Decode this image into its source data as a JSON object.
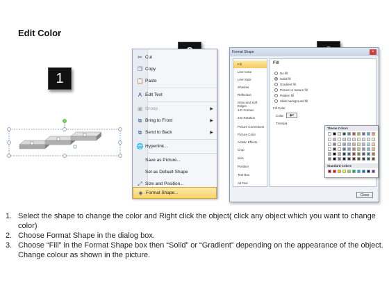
{
  "title": "Edit Color",
  "badges": [
    "1",
    "2",
    "3"
  ],
  "context_menu": {
    "items": [
      {
        "label": "Cut",
        "icon": "scissors-icon"
      },
      {
        "label": "Copy",
        "icon": "copy-icon"
      },
      {
        "label": "Paste",
        "icon": "paste-icon"
      },
      {
        "label": "Edit Text",
        "icon": "edit-text-icon"
      },
      {
        "label": "Group",
        "icon": "group-icon",
        "disabled": true,
        "submenu": true
      },
      {
        "label": "Bring to Front",
        "icon": "bring-front-icon",
        "submenu": true
      },
      {
        "label": "Send to Back",
        "icon": "send-back-icon",
        "submenu": true
      },
      {
        "label": "Hyperlink...",
        "icon": "hyperlink-icon"
      },
      {
        "label": "Save as Picture...",
        "icon": ""
      },
      {
        "label": "Set as Default Shape",
        "icon": ""
      },
      {
        "label": "Size and Position...",
        "icon": "size-icon"
      },
      {
        "label": "Format Shape...",
        "icon": "format-icon",
        "highlighted": true
      }
    ]
  },
  "dialog": {
    "title": "Format Shape",
    "close_glyph": "×",
    "categories": [
      "Fill",
      "Line Color",
      "Line Style",
      "Shadow",
      "Reflection",
      "Glow and Soft Edges",
      "3-D Format",
      "3-D Rotation",
      "Picture Corrections",
      "Picture Color",
      "Artistic Effects",
      "Crop",
      "Size",
      "Position",
      "Text Box",
      "Alt Text"
    ],
    "selected_category": "Fill",
    "fill_heading": "Fill",
    "options": [
      {
        "label": "No fill",
        "on": false
      },
      {
        "label": "Solid fill",
        "on": true
      },
      {
        "label": "Gradient fill",
        "on": false
      },
      {
        "label": "Picture or texture fill",
        "on": false
      },
      {
        "label": "Pattern fill",
        "on": false
      },
      {
        "label": "Slide background fill",
        "on": false
      }
    ],
    "fill_color_label": "Fill Color",
    "color_label": "Color:",
    "transparency_label": "Transpa",
    "theme_colors_label": "Theme Colors",
    "standard_colors_label": "Standard Colors",
    "close_label": "Close",
    "theme_top_row": [
      "#ffffff",
      "#000000",
      "#eeece1",
      "#1f497d",
      "#4f81bd",
      "#c0504d",
      "#9bbb59",
      "#8064a2",
      "#4bacc6",
      "#f79646"
    ],
    "standard_colors": [
      "#c00000",
      "#ff0000",
      "#ffc000",
      "#ffff00",
      "#92d050",
      "#00b050",
      "#00b0f0",
      "#0070c0",
      "#002060",
      "#7030a0"
    ]
  },
  "instructions": [
    {
      "num": "1.",
      "text": "Select the shape to change the color and Right click the object( click any object which you want to change color)"
    },
    {
      "num": "2.",
      "text": "Choose Format Shape in the dialog box."
    },
    {
      "num": "3.",
      "text": "Choose “Fill” in the Format Shape box then “Solid” or “Gradient” depending on the appearance of the object. Change colour as shown in the picture."
    }
  ]
}
